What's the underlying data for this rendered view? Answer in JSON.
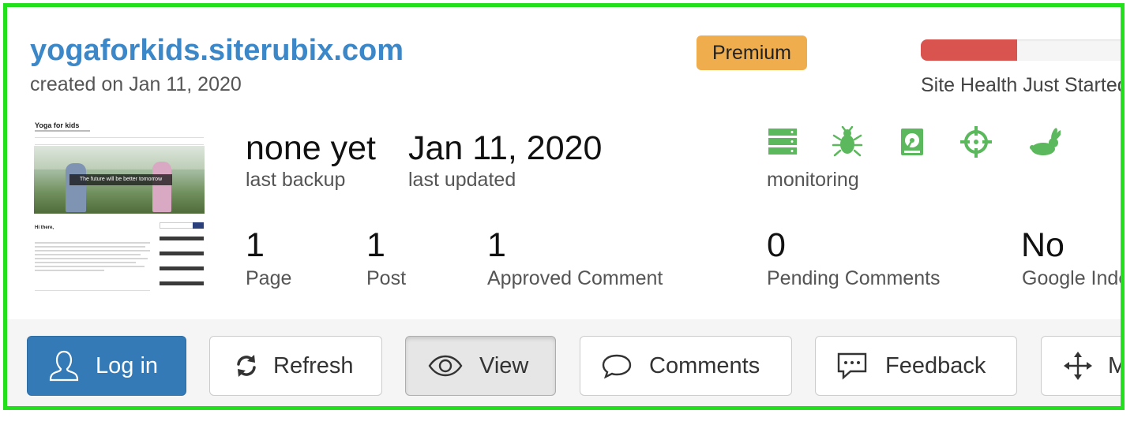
{
  "site": {
    "domain": "yogaforkids.siterubix.com",
    "created": "created on Jan 11, 2020",
    "plan_badge": "Premium",
    "health": {
      "level": 0.38,
      "label": "Site Health Just Started",
      "color": "#d9534f"
    }
  },
  "thumbnail": {
    "site_title": "Yoga for kids",
    "hero_caption": "The future will be better tomorrow",
    "post_heading": "Hi there,"
  },
  "backup": {
    "value": "none yet",
    "label": "last backup"
  },
  "updated": {
    "value": "Jan 11, 2020",
    "label": "last updated"
  },
  "monitoring": {
    "label": "monitoring",
    "icons": [
      "server-icon",
      "bug-icon",
      "disk-icon",
      "crosshair-icon",
      "rabbit-icon"
    ],
    "icon_color": "#5cb85c"
  },
  "counts": [
    {
      "value": "1",
      "label": "Page"
    },
    {
      "value": "1",
      "label": "Post"
    },
    {
      "value": "1",
      "label": "Approved Comment"
    },
    {
      "value": "0",
      "label": "Pending Comments"
    },
    {
      "value": "No",
      "label": "Google Indexed"
    }
  ],
  "actions": {
    "login": "Log in",
    "refresh": "Refresh",
    "view": "View",
    "comments": "Comments",
    "feedback": "Feedback",
    "move": "Move"
  },
  "colors": {
    "accent": "#3b87c8",
    "premium": "#f0ad4e",
    "frame": "#22e01c",
    "primary_button": "#337ab7"
  }
}
